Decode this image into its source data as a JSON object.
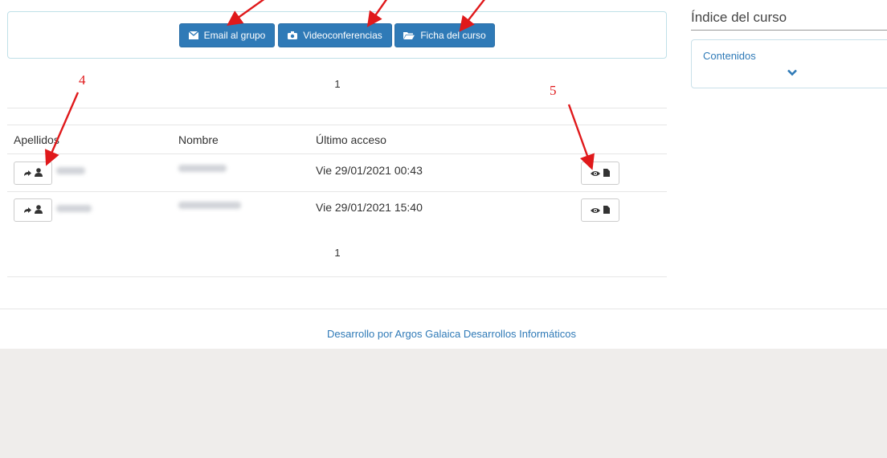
{
  "toolbar": {
    "email_label": "Email al grupo",
    "video_label": "Videoconferencias",
    "ficha_label": "Ficha del curso"
  },
  "pagination": {
    "top": "1",
    "bottom": "1"
  },
  "table": {
    "headers": [
      "Apellidos",
      "Nombre",
      "Último acceso"
    ],
    "rows": [
      {
        "last_access": "Vie 29/01/2021 00:43"
      },
      {
        "last_access": "Vie 29/01/2021 15:40"
      }
    ]
  },
  "sidebar": {
    "title": "Índice del curso",
    "contents_label": "Contenidos"
  },
  "footer": {
    "text": "Desarrollo por Argos Galaica Desarrollos Informáticos"
  },
  "annotations": {
    "n4": "4",
    "n5": "5"
  },
  "colors": {
    "primary": "#2f7ab7",
    "annotation": "#e0191b",
    "footer_bg": "#efedeb"
  },
  "icons": [
    "envelope-icon",
    "camera-icon",
    "folder-open-icon",
    "arrow-right-icon",
    "user-icon",
    "eye-icon",
    "file-icon",
    "chevron-down-icon"
  ]
}
